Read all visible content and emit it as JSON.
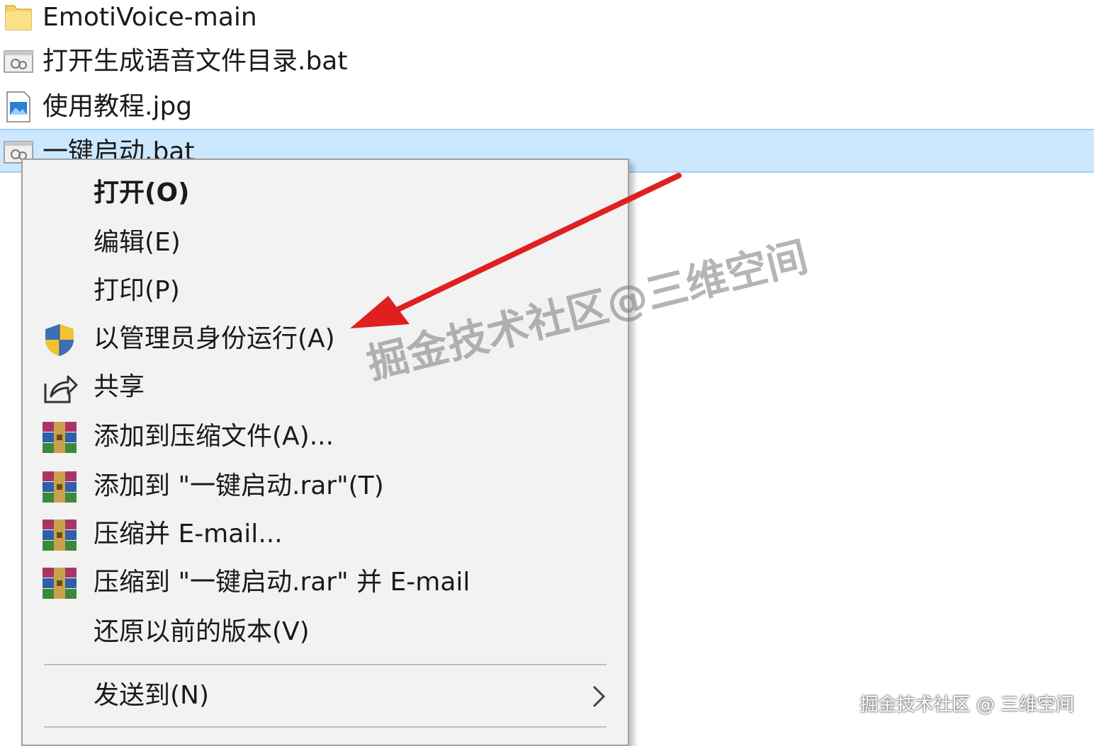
{
  "files": [
    {
      "name": "EmotiVoice-main",
      "icon": "folder-icon"
    },
    {
      "name": "打开生成语音文件目录.bat",
      "icon": "batch-file-icon"
    },
    {
      "name": "使用教程.jpg",
      "icon": "image-file-icon"
    },
    {
      "name": "一键启动.bat",
      "icon": "batch-file-icon",
      "selected": true
    }
  ],
  "context_menu": {
    "items": [
      {
        "label": "打开(O)",
        "icon": null,
        "bold": true
      },
      {
        "label": "编辑(E)",
        "icon": null
      },
      {
        "label": "打印(P)",
        "icon": null
      },
      {
        "label": "以管理员身份运行(A)",
        "icon": "uac-shield-icon"
      },
      {
        "label": "共享",
        "icon": "share-icon"
      },
      {
        "label": "添加到压缩文件(A)...",
        "icon": "winrar-icon"
      },
      {
        "label": "添加到 \"一键启动.rar\"(T)",
        "icon": "winrar-icon"
      },
      {
        "label": "压缩并 E-mail...",
        "icon": "winrar-icon"
      },
      {
        "label": "压缩到 \"一键启动.rar\" 并 E-mail",
        "icon": "winrar-icon"
      },
      {
        "label": "还原以前的版本(V)",
        "icon": null
      },
      {
        "label": "发送到(N)",
        "icon": null,
        "submenu": true
      }
    ]
  },
  "watermark": "掘金技术社区@三维空间",
  "footer_watermark": "掘金技术社区 @ 三维空间",
  "colors": {
    "selection_bg": "#cce8ff",
    "menu_bg": "#f2f2f2",
    "arrow_red": "#e02020"
  }
}
